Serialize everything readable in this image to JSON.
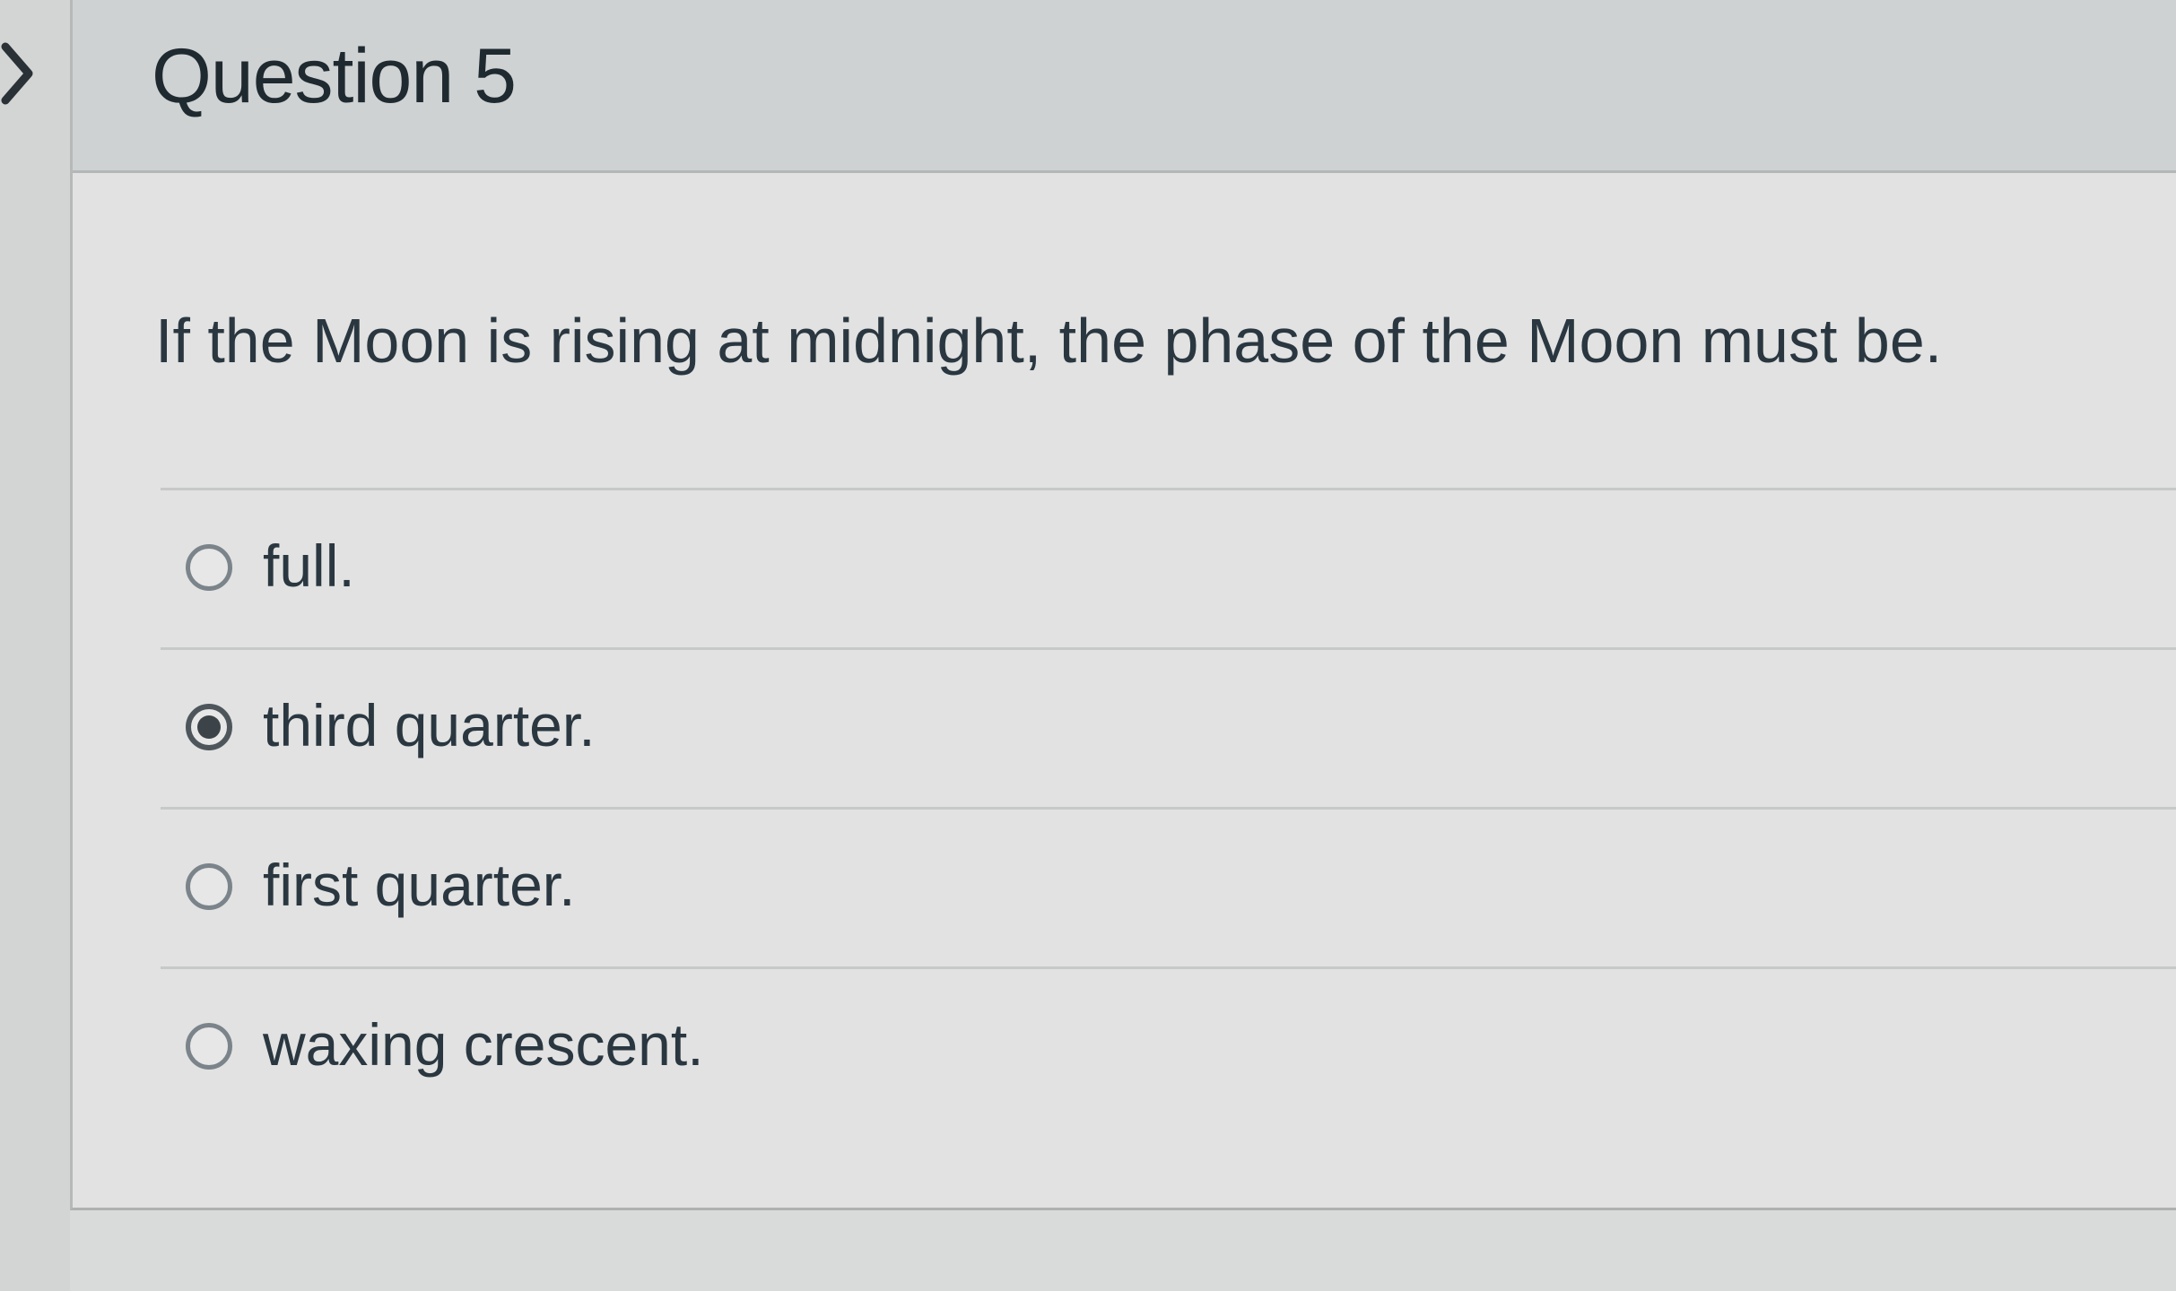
{
  "question": {
    "title": "Question 5",
    "text": "If the Moon is rising at midnight, the phase of the Moon must be.",
    "answers": [
      {
        "label": "full.",
        "selected": false
      },
      {
        "label": "third quarter.",
        "selected": true
      },
      {
        "label": "first quarter.",
        "selected": false
      },
      {
        "label": "waxing crescent.",
        "selected": false
      }
    ]
  },
  "navigation": {
    "toggle_icon": "chevron-right-icon"
  }
}
